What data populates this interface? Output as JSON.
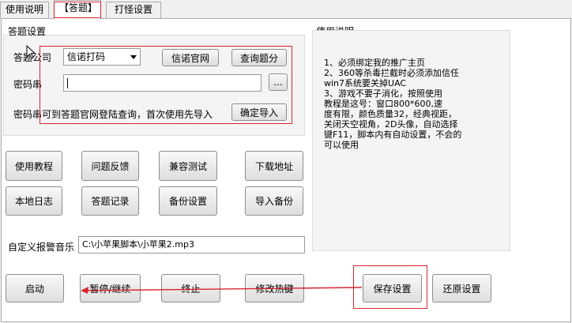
{
  "tabs": [
    {
      "label": "使用说明",
      "active": false
    },
    {
      "label": "【答题】",
      "active": true
    },
    {
      "label": "打怪设置",
      "active": false
    }
  ],
  "answer_settings": {
    "title": "答题设置",
    "company_label": "答题公司",
    "company_value": "信诺打码",
    "official_site_button": "信诺官网",
    "query_points_button": "查询题分",
    "password_label": "密码串",
    "password_value": "",
    "browse_button": "...",
    "hint_text": "密码串可到答题官网登陆查询，首次使用先导入",
    "confirm_import_button": "确定导入"
  },
  "instructions": {
    "title": "使用说明",
    "text": "1、必须绑定我的推广主页\n2、360等杀毒拦截时必须添加信任\nwin7系统要关掉UAC\n3、游戏不要子消化，按照使用\n教程是这号：窗口800*600,速\n度有限，颜色质量32，经典视距，\n关闭天空视角，2D头像，自动选择\n键F11，脚本内有自动设置，不会的\n可以使用"
  },
  "tool_buttons": {
    "tutorial": "使用教程",
    "feedback": "问题反馈",
    "compat_test": "兼容测试",
    "download": "下载地址",
    "local_log": "本地日志",
    "answer_records": "答题记录",
    "backup_settings": "备份设置",
    "import_backup": "导入备份"
  },
  "alarm": {
    "label": "自定义报警音乐",
    "path": "C:\\小苹果脚本\\小苹果2.mp3"
  },
  "bottom_buttons": {
    "start": "启动",
    "pause_resume": "暂停/继续",
    "stop": "终止",
    "modify_hotkey": "修改热键",
    "save_settings": "保存设置",
    "restore_settings": "还原设置"
  },
  "colors": {
    "annotation_red": "#d8262f"
  }
}
